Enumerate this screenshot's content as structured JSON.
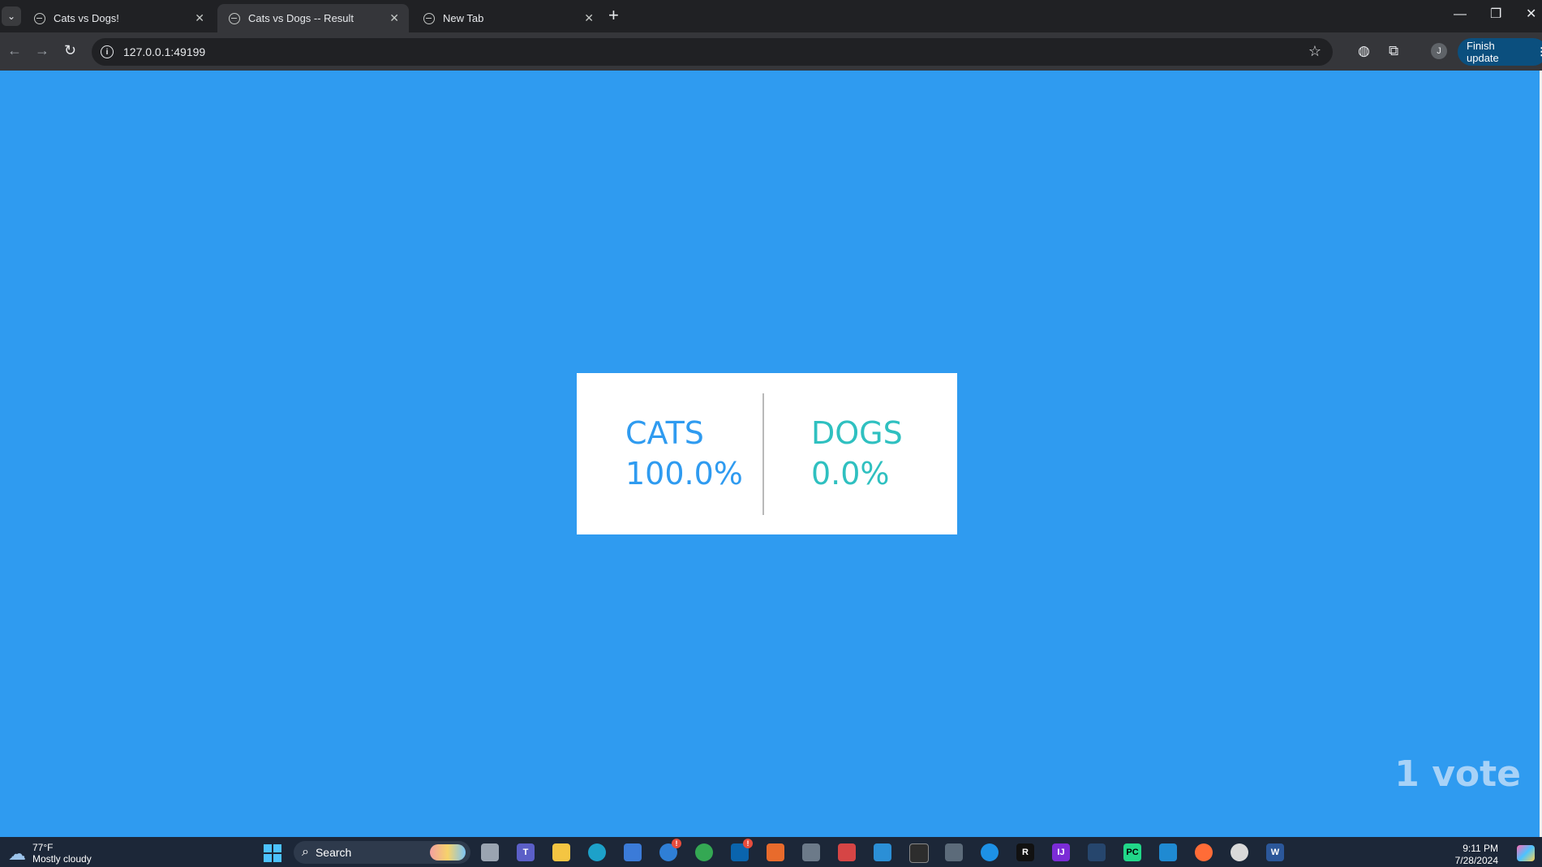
{
  "browser": {
    "tabs": [
      {
        "title": "Cats vs Dogs!",
        "active": false
      },
      {
        "title": "Cats vs Dogs -- Result",
        "active": true
      },
      {
        "title": "New Tab",
        "active": false
      }
    ],
    "url": "127.0.0.1:49199",
    "profile_initial": "J",
    "update_label": "Finish update"
  },
  "result": {
    "cats_label": "CATS",
    "cats_percent": "100.0%",
    "dogs_label": "DOGS",
    "dogs_percent": "0.0%",
    "vote_count": "1 vote"
  },
  "colors": {
    "page_background": "#2f9bf0",
    "cats_color": "#2f9bf0",
    "dogs_color": "#2fc0c0"
  },
  "taskbar": {
    "weather_temp": "77°F",
    "weather_condition": "Mostly cloudy",
    "search_placeholder": "Search",
    "time": "9:11 PM",
    "date": "7/28/2024",
    "apps": [
      "file-explorer-icon",
      "teams-icon",
      "folder-icon",
      "edge-icon",
      "store-icon",
      "app-icon",
      "chrome-icon",
      "outlook-icon",
      "app-icon",
      "calculator-icon",
      "snipping-icon",
      "app-icon",
      "terminal-icon",
      "app-icon",
      "docker-icon",
      "rider-icon",
      "intellij-icon",
      "app-icon",
      "pycharm-icon",
      "vscode-icon",
      "postman-icon",
      "app-icon",
      "word-icon"
    ]
  }
}
